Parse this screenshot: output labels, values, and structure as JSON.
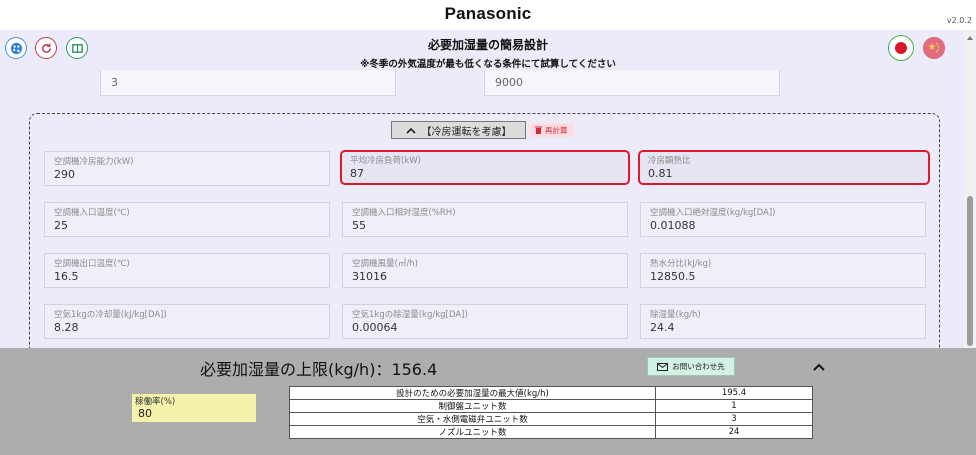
{
  "brand": "Panasonic",
  "version": "v2.0.2",
  "header": {
    "title": "必要加湿量の簡易設計",
    "subtitle": "※冬季の外気温度が最も低くなる条件にて試算してください"
  },
  "colors": {
    "accent_red": "#e0182c",
    "bottom_panel": "#adadad",
    "main_bg": "#ecebf9"
  },
  "toolbar": {
    "left_icons": [
      "palette-icon",
      "reset-icon",
      "manual-book-icon"
    ],
    "right_icons": [
      "flag-japan-icon",
      "flag-china-icon"
    ]
  },
  "prev_fields": [
    {
      "value": "3"
    },
    {
      "value": "9000"
    }
  ],
  "cooling_section": {
    "toggle_label": "【冷房運転を考慮】",
    "recalc_label": "再計算"
  },
  "fields": [
    {
      "label": "空調機冷房能力(kW)",
      "value": "290"
    },
    {
      "label": "平均冷房負荷(kW)",
      "value": "87"
    },
    {
      "label": "冷房顕熱比",
      "value": "0.81"
    },
    {
      "label": "空調機入口温度(℃)",
      "value": "25"
    },
    {
      "label": "空調機入口相対湿度(%RH)",
      "value": "55"
    },
    {
      "label": "空調機入口絶対湿度(kg/kg[DA])",
      "value": "0.01088"
    },
    {
      "label": "空調機出口温度(℃)",
      "value": "16.5"
    },
    {
      "label": "空調機風量(㎥/h)",
      "value": "31016"
    },
    {
      "label": "熱水分比(kJ/kg)",
      "value": "12850.5"
    },
    {
      "label": "空気1kgの冷却量(kJ/kg[DA])",
      "value": "8.28"
    },
    {
      "label": "空気1kgの除湿量(kg/kg[DA])",
      "value": "0.00064"
    },
    {
      "label": "除湿量(kg/h)",
      "value": "24.4"
    }
  ],
  "bottom": {
    "limit_text": "必要加湿量の上限(kg/h)：156.4",
    "contact_label": "お問い合わせ先",
    "rate_label": "稼働率(%)",
    "rate_value": "80",
    "results": [
      {
        "label": "設計のための必要加湿量の最大値(kg/h)",
        "value": "195.4"
      },
      {
        "label": "制御盤ユニット数",
        "value": "1"
      },
      {
        "label": "空気・水側電磁弁ユニット数",
        "value": "3"
      },
      {
        "label": "ノズルユニット数",
        "value": "24"
      }
    ]
  }
}
